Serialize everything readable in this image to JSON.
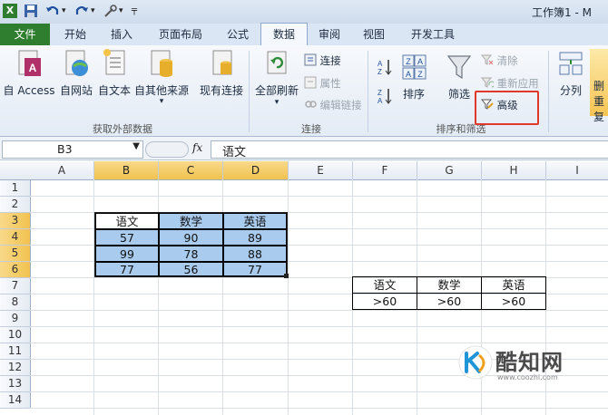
{
  "quick_access": {
    "title": "工作簿1 - M"
  },
  "tabs": [
    {
      "label": "文件"
    },
    {
      "label": "开始"
    },
    {
      "label": "插入"
    },
    {
      "label": "页面布局"
    },
    {
      "label": "公式"
    },
    {
      "label": "数据"
    },
    {
      "label": "审阅"
    },
    {
      "label": "视图"
    },
    {
      "label": "开发工具"
    }
  ],
  "ribbon": {
    "get_external": {
      "from_access": "自 Access",
      "from_web": "自网站",
      "from_text": "自文本",
      "from_other": "自其他来源",
      "existing": "现有连接",
      "group_label": "获取外部数据"
    },
    "connections": {
      "refresh_all": "全部刷新",
      "connections": "连接",
      "properties": "属性",
      "edit_links": "编辑链接",
      "group_label": "连接"
    },
    "sort_filter": {
      "sort": "排序",
      "filter": "筛选",
      "clear": "清除",
      "reapply": "重新应用",
      "advanced": "高级",
      "group_label": "排序和筛选"
    },
    "data_tools": {
      "text_to_columns": "分列",
      "remove_dup_1": "删",
      "remove_dup_2": "重复"
    }
  },
  "formula_bar": {
    "name_box": "B3",
    "fx": "fx",
    "content": "语文"
  },
  "columns": [
    "A",
    "B",
    "C",
    "D",
    "E",
    "F",
    "G",
    "H",
    "I"
  ],
  "rows": [
    "1",
    "2",
    "3",
    "4",
    "5",
    "6",
    "7",
    "8",
    "9",
    "10",
    "11",
    "12",
    "13",
    "14"
  ],
  "table1": {
    "headers": [
      "语文",
      "数学",
      "英语"
    ],
    "rows": [
      [
        "57",
        "90",
        "89"
      ],
      [
        "99",
        "78",
        "88"
      ],
      [
        "77",
        "56",
        "77"
      ]
    ]
  },
  "table2": {
    "headers": [
      "语文",
      "数学",
      "英语"
    ],
    "rows": [
      [
        ">60",
        ">60",
        ">60"
      ]
    ]
  },
  "watermark": {
    "text": "酷知网",
    "url": "www.coozhi.com"
  },
  "colors": {
    "accent": "#2f7d2f",
    "selection": "#a9cbee",
    "highlight_box": "#e0392c"
  }
}
